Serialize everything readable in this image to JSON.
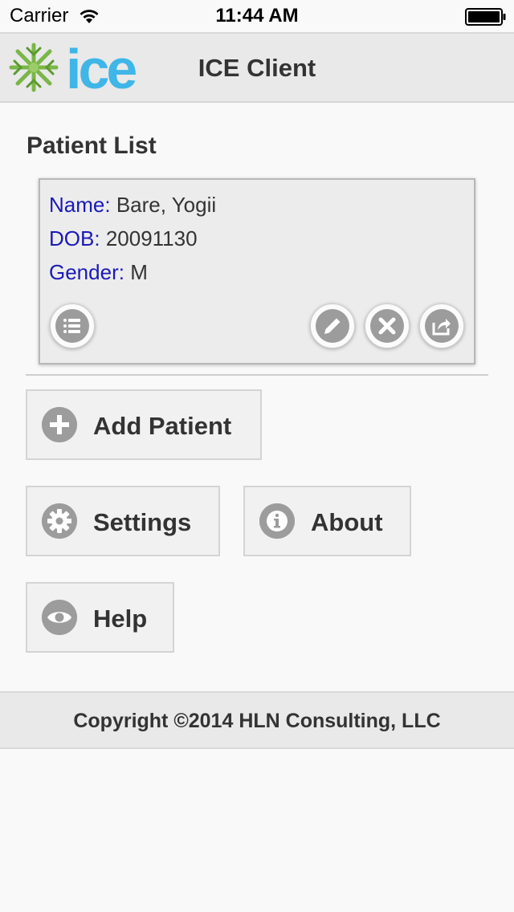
{
  "status_bar": {
    "carrier": "Carrier",
    "time": "11:44 AM"
  },
  "header": {
    "logo_text": "ice",
    "title": "ICE Client"
  },
  "patient_list": {
    "title": "Patient List",
    "patients": [
      {
        "name_label": "Name:",
        "name": "Bare, Yogii",
        "dob_label": "DOB:",
        "dob": "20091130",
        "gender_label": "Gender:",
        "gender": "M"
      }
    ]
  },
  "actions": {
    "add_patient": "Add Patient",
    "settings": "Settings",
    "about": "About",
    "help": "Help"
  },
  "footer": {
    "copyright": "Copyright ©2014 HLN Consulting, LLC"
  },
  "icons": {
    "list": "list-icon",
    "edit": "pencil-icon",
    "delete": "close-icon",
    "share": "share-icon",
    "add": "plus-icon",
    "settings": "gear-icon",
    "about": "info-icon",
    "help": "eye-icon"
  },
  "colors": {
    "field_label": "#1a1ab8",
    "logo_blue": "#3fb6e7",
    "logo_green": "#7ab648",
    "icon_gray": "#9c9c9c"
  }
}
